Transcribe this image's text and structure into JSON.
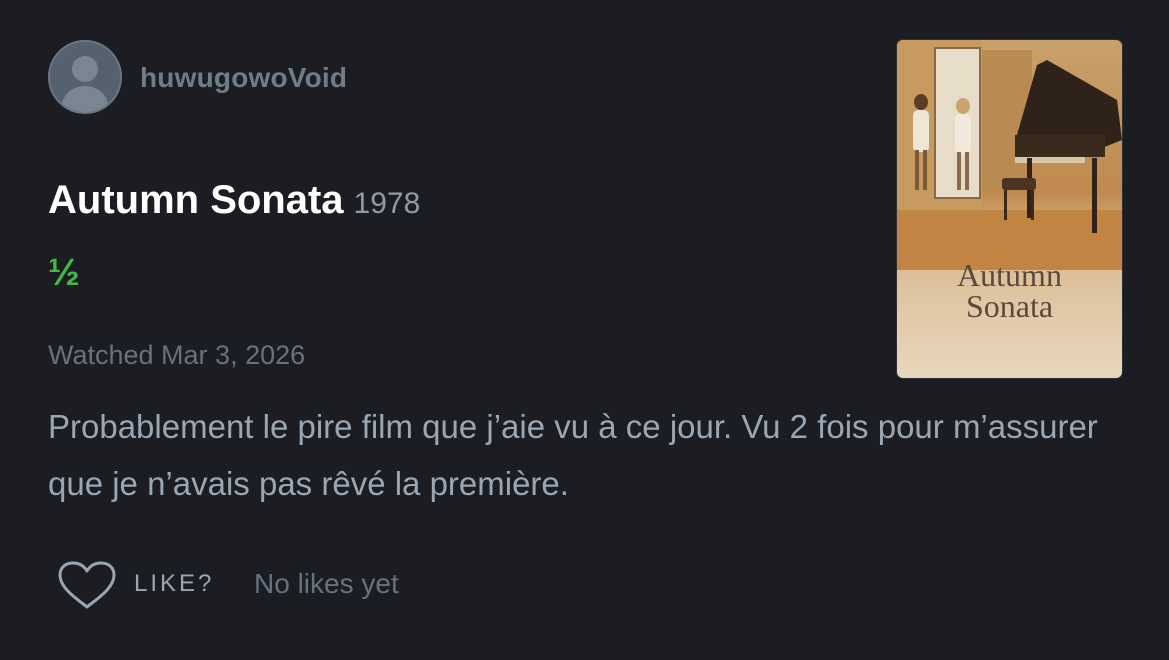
{
  "review": {
    "username": "huwugowoVoid",
    "film_title": "Autumn Sonata",
    "film_year": "1978",
    "rating": "½",
    "watched": "Watched Mar 3, 2026",
    "text": "Probablement le pire film que j’aie vu à ce jour. Vu 2 fois pour m’assurer que je n’avais pas rêvé la première."
  },
  "poster": {
    "title_line1": "Autumn",
    "title_line2": "Sonata"
  },
  "actions": {
    "like_label": "LIKE?",
    "likes_status": "No likes yet"
  },
  "icons": {
    "avatar": "user-avatar-icon",
    "like": "heart-icon"
  },
  "colors": {
    "background": "#1b1d22",
    "rating_green": "#40bc40",
    "title_white": "#ffffff",
    "muted_text": "#66727f"
  }
}
